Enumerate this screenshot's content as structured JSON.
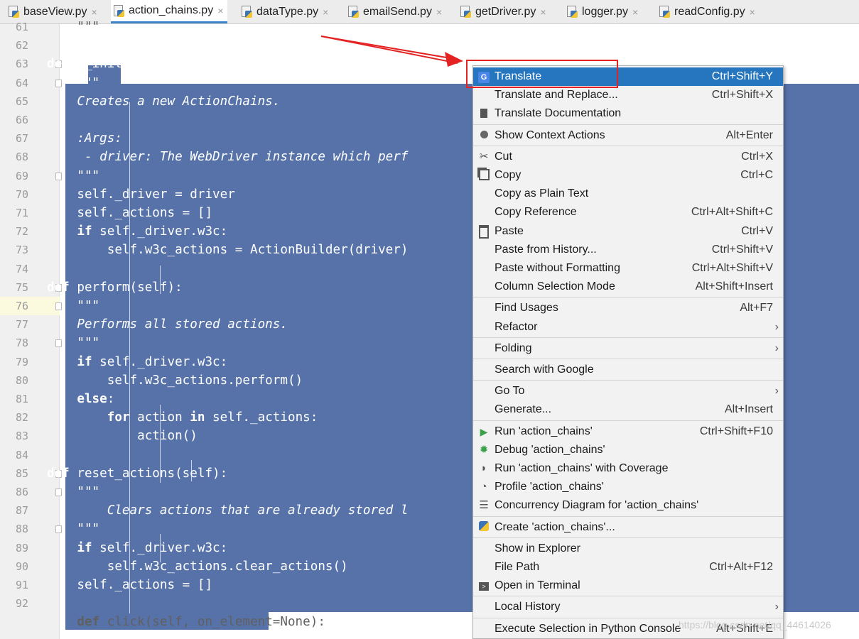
{
  "tabs": [
    {
      "label": "baseView.py",
      "active": false
    },
    {
      "label": "action_chains.py",
      "active": true
    },
    {
      "label": "dataType.py",
      "active": false
    },
    {
      "label": "emailSend.py",
      "active": false
    },
    {
      "label": "getDriver.py",
      "active": false
    },
    {
      "label": "logger.py",
      "active": false
    },
    {
      "label": "readConfig.py",
      "active": false
    }
  ],
  "tab_close_glyph": "×",
  "editor": {
    "line_numbers": [
      "61",
      "62",
      "63",
      "64",
      "65",
      "66",
      "67",
      "68",
      "69",
      "70",
      "71",
      "72",
      "73",
      "74",
      "75",
      "76",
      "77",
      "78",
      "79",
      "80",
      "81",
      "82",
      "83",
      "84",
      "85",
      "86",
      "87",
      "88",
      "89",
      "90",
      "91",
      "92"
    ],
    "current_line": "76",
    "lines": [
      "    \"\"\"",
      "",
      "def __init__(self, driver):",
      "    \"\"\"",
      "    Creates a new ActionChains.",
      "",
      "    :Args:",
      "     - driver: The WebDriver instance which perf",
      "    \"\"\"",
      "    self._driver = driver",
      "    self._actions = []",
      "    if self._driver.w3c:",
      "        self.w3c_actions = ActionBuilder(driver)",
      "",
      "def perform(self):",
      "    \"\"\"",
      "    Performs all stored actions.",
      "    \"\"\"",
      "    if self._driver.w3c:",
      "        self.w3c_actions.perform()",
      "    else:",
      "        for action in self._actions:",
      "            action()",
      "",
      "def reset_actions(self):",
      "    \"\"\"",
      "        Clears actions that are already stored l",
      "    \"\"\"",
      "    if self._driver.w3c:",
      "        self.w3c_actions.clear_actions()",
      "    self._actions = []",
      "",
      "    def click(self, on_element=None):"
    ]
  },
  "context_menu": {
    "items": [
      {
        "label": "Translate",
        "shortcut": "Ctrl+Shift+Y",
        "icon": "google-translate-icon",
        "highlighted": true
      },
      {
        "label": "Translate and Replace...",
        "shortcut": "Ctrl+Shift+X",
        "icon": ""
      },
      {
        "label": "Translate Documentation",
        "shortcut": "",
        "icon": "document-icon"
      },
      {
        "sep": true
      },
      {
        "label": "Show Context Actions",
        "shortcut": "Alt+Enter",
        "icon": "lightbulb-icon"
      },
      {
        "sep": true
      },
      {
        "label": "Cut",
        "shortcut": "Ctrl+X",
        "icon": "scissors-icon"
      },
      {
        "label": "Copy",
        "shortcut": "Ctrl+C",
        "icon": "copy-icon"
      },
      {
        "label": "Copy as Plain Text",
        "shortcut": "",
        "icon": ""
      },
      {
        "label": "Copy Reference",
        "shortcut": "Ctrl+Alt+Shift+C",
        "icon": ""
      },
      {
        "label": "Paste",
        "shortcut": "Ctrl+V",
        "icon": "clipboard-icon"
      },
      {
        "label": "Paste from History...",
        "shortcut": "Ctrl+Shift+V",
        "icon": ""
      },
      {
        "label": "Paste without Formatting",
        "shortcut": "Ctrl+Alt+Shift+V",
        "icon": ""
      },
      {
        "label": "Column Selection Mode",
        "shortcut": "Alt+Shift+Insert",
        "icon": ""
      },
      {
        "sep": true
      },
      {
        "label": "Find Usages",
        "shortcut": "Alt+F7",
        "icon": ""
      },
      {
        "label": "Refactor",
        "shortcut": "",
        "icon": "",
        "submenu": true
      },
      {
        "sep": true
      },
      {
        "label": "Folding",
        "shortcut": "",
        "icon": "",
        "submenu": true
      },
      {
        "sep": true
      },
      {
        "label": "Search with Google",
        "shortcut": "",
        "icon": ""
      },
      {
        "sep": true
      },
      {
        "label": "Go To",
        "shortcut": "",
        "icon": "",
        "submenu": true
      },
      {
        "label": "Generate...",
        "shortcut": "Alt+Insert",
        "icon": ""
      },
      {
        "sep": true
      },
      {
        "label": "Run 'action_chains'",
        "shortcut": "Ctrl+Shift+F10",
        "icon": "run-icon"
      },
      {
        "label": "Debug 'action_chains'",
        "shortcut": "",
        "icon": "bug-icon"
      },
      {
        "label": "Run 'action_chains' with Coverage",
        "shortcut": "",
        "icon": "coverage-icon"
      },
      {
        "label": "Profile 'action_chains'",
        "shortcut": "",
        "icon": "profile-icon"
      },
      {
        "label": "Concurrency Diagram for 'action_chains'",
        "shortcut": "",
        "icon": "concurrency-icon"
      },
      {
        "sep": true
      },
      {
        "label": "Create 'action_chains'...",
        "shortcut": "",
        "icon": "python-icon"
      },
      {
        "sep": true
      },
      {
        "label": "Show in Explorer",
        "shortcut": "",
        "icon": ""
      },
      {
        "label": "File Path",
        "shortcut": "Ctrl+Alt+F12",
        "icon": ""
      },
      {
        "label": "Open in Terminal",
        "shortcut": "",
        "icon": "terminal-icon"
      },
      {
        "sep": true
      },
      {
        "label": "Local History",
        "shortcut": "",
        "icon": "",
        "submenu": true
      },
      {
        "sep": true
      },
      {
        "label": "Execute Selection in Python Console",
        "shortcut": "Alt+Shift+E",
        "icon": ""
      }
    ]
  },
  "submenu_arrow": "›",
  "watermark": "https://blog.csdn.net/qq_44614026",
  "colors": {
    "selection": "#5672a8",
    "menu_highlight": "#2675bf",
    "annotation": "#e52222"
  }
}
